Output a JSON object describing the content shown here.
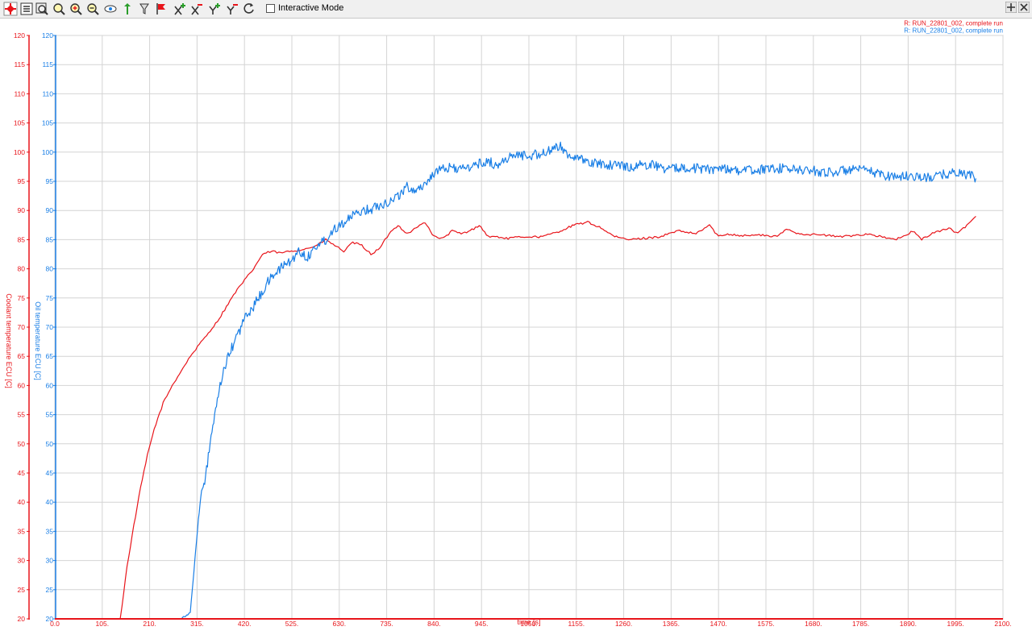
{
  "toolbar": {
    "icons": [
      "close-red-icon",
      "list-icon",
      "zoom-window-icon",
      "zoom-select-icon",
      "zoom-in-icon",
      "zoom-out-icon",
      "eye-icon",
      "pan-y-icon",
      "filter-icon",
      "flag-icon",
      "x-plus-icon",
      "x-minus-icon",
      "y-plus-icon",
      "y-minus-icon",
      "refresh-icon"
    ],
    "interactive_label": "Interactive Mode",
    "interactive_checked": false
  },
  "colors": {
    "red": "#e8141a",
    "blue": "#1a7fe6",
    "grid": "#d4d4d4"
  },
  "chart_data": {
    "type": "line",
    "xlabel": "time [s]",
    "xlim": [
      0,
      2100
    ],
    "xticks": [
      "0.0",
      "105.",
      "210.",
      "315.",
      "420.",
      "525.",
      "630.",
      "735.",
      "840.",
      "945.",
      "1050.",
      "1155.",
      "1260.",
      "1365.",
      "1470.",
      "1575.",
      "1680.",
      "1785.",
      "1890.",
      "1995.",
      "2100."
    ],
    "y_axes": [
      {
        "label": "Coolant temperature ECU [C]",
        "color": "#e8141a",
        "ylim": [
          20,
          120
        ]
      },
      {
        "label": "Oil temperature ECU [C]",
        "color": "#1a7fe6",
        "ylim": [
          20,
          120
        ]
      }
    ],
    "yticks": [
      "20",
      "25",
      "30",
      "35",
      "40",
      "45",
      "50",
      "55",
      "60",
      "65",
      "70",
      "75",
      "80",
      "85",
      "90",
      "95",
      "100",
      "105",
      "110",
      "115",
      "120"
    ],
    "grid": true,
    "legend_position": "top-right",
    "series": [
      {
        "name": "R: RUN_22801_002, complete run",
        "axis": 0,
        "color": "#e8141a",
        "x": [
          145,
          160,
          175,
          190,
          205,
          220,
          240,
          260,
          280,
          300,
          320,
          340,
          360,
          380,
          400,
          420,
          440,
          460,
          480,
          500,
          520,
          540,
          560,
          580,
          600,
          620,
          640,
          660,
          680,
          700,
          720,
          740,
          760,
          780,
          800,
          820,
          840,
          860,
          880,
          900,
          920,
          940,
          960,
          980,
          1000,
          1040,
          1080,
          1120,
          1150,
          1180,
          1210,
          1240,
          1270,
          1300,
          1340,
          1380,
          1420,
          1450,
          1470,
          1490,
          1520,
          1560,
          1600,
          1620,
          1650,
          1700,
          1740,
          1780,
          1800,
          1830,
          1860,
          1880,
          1900,
          1920,
          1940,
          1960,
          1980,
          2000,
          2020,
          2040
        ],
        "y": [
          20,
          29,
          36,
          42.5,
          48,
          52.5,
          57,
          60,
          62.5,
          65,
          67,
          69,
          71,
          73.5,
          76,
          78,
          80,
          82.5,
          83,
          82.7,
          83,
          83.2,
          83.5,
          84,
          85,
          84,
          83,
          84.5,
          84,
          82.5,
          83.5,
          86,
          87.5,
          86,
          87,
          88,
          85.5,
          85.2,
          86.5,
          86,
          86.5,
          87.5,
          85.5,
          85.5,
          85.2,
          85.5,
          85.5,
          86.5,
          87.5,
          88,
          87,
          85.5,
          85,
          85.2,
          85.5,
          86.5,
          86,
          87.5,
          85.5,
          86,
          85.7,
          85.8,
          85.5,
          86.8,
          86,
          85.8,
          85.5,
          85.8,
          86,
          85.5,
          85,
          85.5,
          86.5,
          85,
          86,
          86.5,
          87,
          86,
          87.5,
          89
        ]
      },
      {
        "name": "R: RUN_22801_002, complete run",
        "axis": 1,
        "color": "#1a7fe6",
        "x": [
          277,
          300,
          310,
          318,
          325,
          332,
          340,
          350,
          360,
          370,
          380,
          390,
          400,
          410,
          420,
          430,
          440,
          450,
          460,
          470,
          480,
          490,
          500,
          510,
          520,
          530,
          540,
          550,
          560,
          570,
          580,
          590,
          600,
          610,
          620,
          640,
          660,
          680,
          700,
          720,
          740,
          760,
          780,
          800,
          820,
          840,
          860,
          880,
          900,
          920,
          940,
          960,
          980,
          1000,
          1030,
          1060,
          1090,
          1120,
          1140,
          1170,
          1200,
          1240,
          1280,
          1320,
          1360,
          1400,
          1440,
          1480,
          1520,
          1560,
          1600,
          1640,
          1680,
          1720,
          1760,
          1800,
          1840,
          1880,
          1900,
          1930,
          1960,
          1990,
          2020,
          2040
        ],
        "y": [
          20,
          21,
          30,
          37,
          42,
          43,
          48,
          53,
          57,
          61.5,
          64,
          66,
          68,
          69.5,
          71.5,
          72.5,
          73.5,
          75,
          76,
          77.5,
          78.5,
          79.5,
          80,
          81,
          81,
          82,
          83,
          82.5,
          82,
          83,
          84,
          84.5,
          85,
          86,
          87,
          88,
          89,
          90,
          90.2,
          91,
          91.5,
          92.5,
          94,
          93.5,
          94.5,
          96.5,
          97,
          97.5,
          97,
          97.5,
          98,
          98.5,
          97.5,
          99,
          99.5,
          99.5,
          100,
          101,
          99.5,
          98.5,
          98,
          97.8,
          97.5,
          98,
          97,
          97.5,
          97,
          97.3,
          96.8,
          97,
          97.2,
          97,
          96.8,
          96.5,
          97,
          96.8,
          96,
          95.8,
          96,
          95.5,
          96,
          96.5,
          96.2,
          95.5
        ]
      }
    ]
  }
}
